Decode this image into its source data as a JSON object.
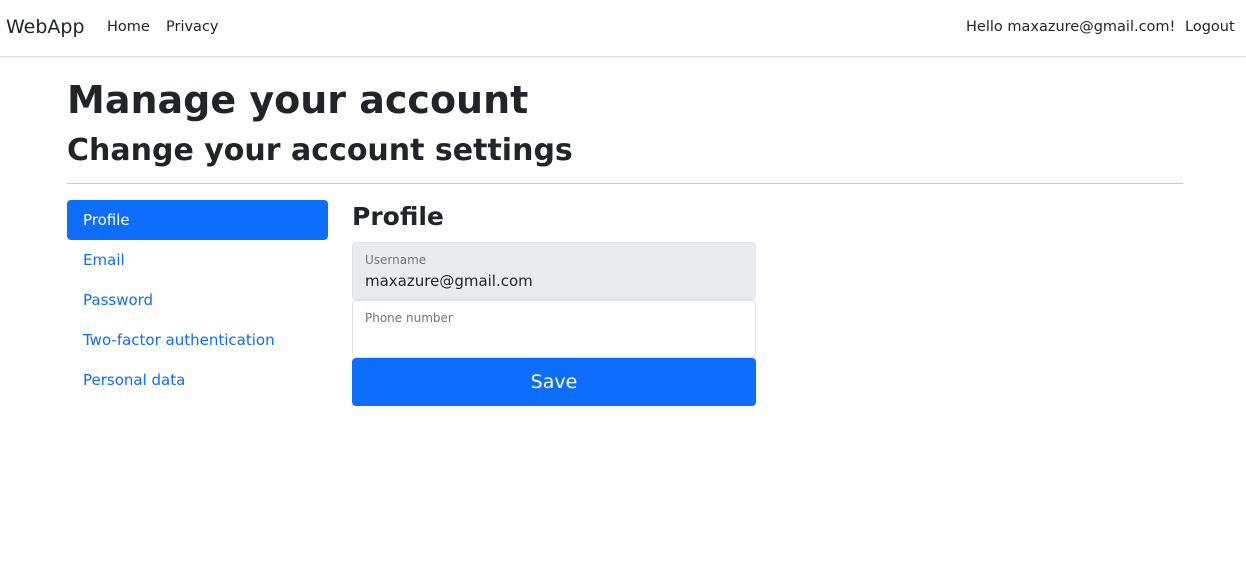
{
  "navbar": {
    "brand": "WebApp",
    "links": [
      "Home",
      "Privacy"
    ],
    "greeting": "Hello maxazure@gmail.com!",
    "logout": "Logout"
  },
  "page": {
    "title": "Manage your account",
    "subtitle": "Change your account settings"
  },
  "sidebar": {
    "items": [
      {
        "label": "Profile",
        "active": true
      },
      {
        "label": "Email",
        "active": false
      },
      {
        "label": "Password",
        "active": false
      },
      {
        "label": "Two-factor authentication",
        "active": false
      },
      {
        "label": "Personal data",
        "active": false
      }
    ]
  },
  "profile": {
    "title": "Profile",
    "username": {
      "label": "Username",
      "value": "maxazure@gmail.com"
    },
    "phone": {
      "label": "Phone number",
      "value": ""
    },
    "save_label": "Save"
  },
  "colors": {
    "primary": "#0d6efd",
    "disabled_bg": "#e9ecef",
    "text": "#212529",
    "muted": "#6c757d"
  }
}
